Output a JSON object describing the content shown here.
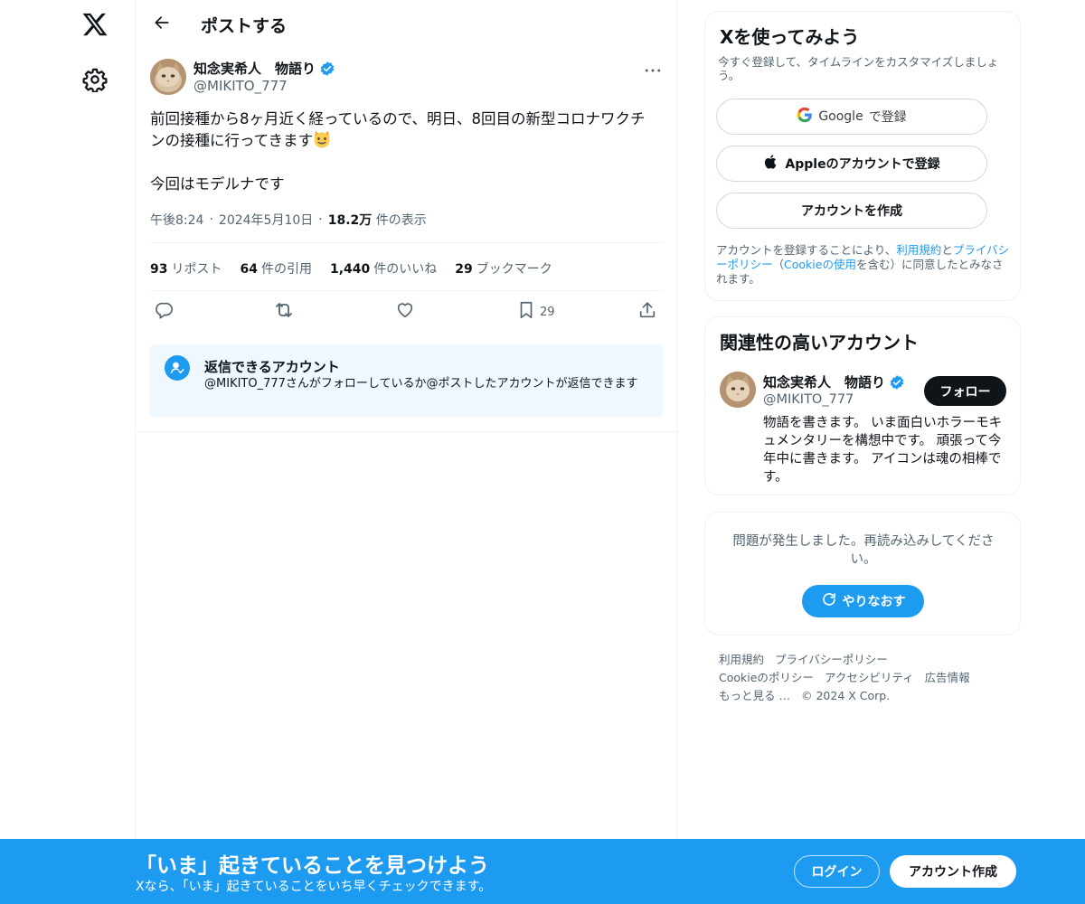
{
  "header": {
    "title": "ポストする"
  },
  "post": {
    "author_name": "知念実希人　物語り",
    "author_handle": "@MIKITO_777",
    "text_line1": "前回接種から8ヶ月近く経っているので、明日、8回目の新型コロナワクチ",
    "text_line2": "ンの接種に行ってきます",
    "text_line3": "今回はモデルナです",
    "time": "午後8:24",
    "date": "2024年5月10日",
    "views_count": "18.2万",
    "views_label": "件の表示",
    "stats": {
      "reposts_count": "93",
      "reposts_label": "リポスト",
      "quotes_count": "64",
      "quotes_label": "件の引用",
      "likes_count": "1,440",
      "likes_label": "件のいいね",
      "bookmarks_count": "29",
      "bookmarks_label": "ブックマーク"
    },
    "actions": {
      "bookmark_count": "29"
    },
    "reply_restriction": {
      "title": "返信できるアカウント",
      "description": "@MIKITO_777さんがフォローしているか@ポストしたアカウントが返信できます"
    }
  },
  "signup": {
    "title": "Xを使ってみよう",
    "description": "今すぐ登録して、タイムラインをカスタマイズしましょう。",
    "google_brand": "Google",
    "google_suffix": "で登録",
    "apple_label": "Appleのアカウントで登録",
    "create_label": "アカウントを作成",
    "legal_1": "アカウントを登録することにより、",
    "legal_terms": "利用規約",
    "legal_and": "と",
    "legal_privacy": "プライバシーポリシー",
    "legal_2": "（",
    "legal_cookie": "Cookieの使用",
    "legal_3": "を含む）に同意したとみなされます。"
  },
  "related": {
    "title": "関連性の高いアカウント",
    "name": "知念実希人　物語り",
    "handle": "@MIKITO_777",
    "follow_label": "フォロー",
    "bio": "物語を書きます。 いま面白いホラーモキュメンタリーを構想中です。 頑張って今年中に書きます。 アイコンは魂の相棒です。"
  },
  "error_card": {
    "message": "問題が発生しました。再読み込みしてください。",
    "retry_label": "やりなおす"
  },
  "footer": {
    "terms": "利用規約",
    "privacy": "プライバシーポリシー",
    "cookie": "Cookieのポリシー",
    "accessibility": "アクセシビリティ",
    "ads": "広告情報",
    "more": "もっと見る …",
    "copyright": "© 2024 X Corp."
  },
  "banner": {
    "title": "「いま」起きていることを見つけよう",
    "subtitle": "Xなら、「いま」起きていることをいち早くチェックできます。",
    "login_label": "ログイン",
    "signup_label": "アカウント作成"
  },
  "colors": {
    "accent": "#1d9bf0",
    "text_primary": "#0f1419",
    "text_secondary": "#536471",
    "border": "#eff3f4",
    "reply_box_bg": "#eff8fe"
  },
  "icons": {
    "logo": "x-logo-icon",
    "settings": "gear-icon",
    "back": "arrow-left-icon",
    "more": "more-horizontal-icon",
    "verified": "verified-badge-icon",
    "reply": "reply-icon",
    "repost": "repost-icon",
    "like": "heart-icon",
    "bookmark": "bookmark-icon",
    "share": "share-icon",
    "mention": "mention-person-icon",
    "google": "google-logo-icon",
    "apple": "apple-logo-icon",
    "retry": "refresh-icon",
    "emoji": "grinning-cat-emoji"
  }
}
